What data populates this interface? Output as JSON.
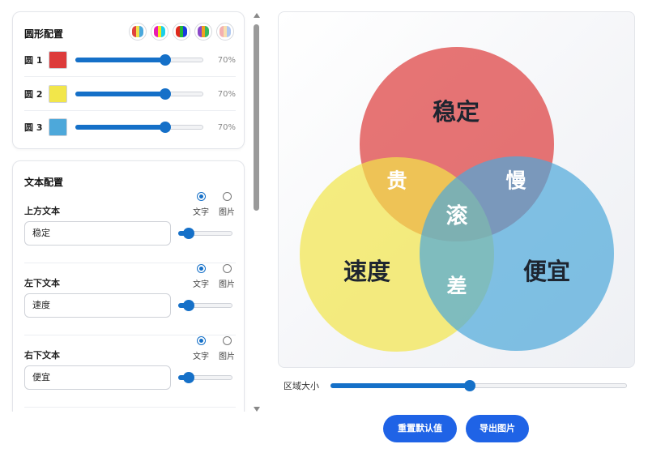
{
  "shape_panel": {
    "title": "圆形配置",
    "presets": [
      {
        "name": "palette-1",
        "colors": [
          "#e0443c",
          "#f0e04a",
          "#4aa8dc"
        ]
      },
      {
        "name": "palette-2",
        "colors": [
          "#e81cb0",
          "#f5e81a",
          "#1ad0e8"
        ]
      },
      {
        "name": "palette-3",
        "colors": [
          "#e0281c",
          "#22b83a",
          "#1a3ae0"
        ]
      },
      {
        "name": "palette-4",
        "colors": [
          "#8a48c8",
          "#f0a020",
          "#38b860"
        ]
      },
      {
        "name": "palette-5",
        "colors": [
          "#f4b0b0",
          "#f8e0b0",
          "#b0c8f0"
        ]
      }
    ],
    "circles": [
      {
        "label": "圆 1",
        "color": "#dd3b3b",
        "opacity_text": "70%",
        "opacity": 0.7
      },
      {
        "label": "圆 2",
        "color": "#f2e64a",
        "opacity_text": "70%",
        "opacity": 0.7
      },
      {
        "label": "圆 3",
        "color": "#4da8da",
        "opacity_text": "70%",
        "opacity": 0.7
      }
    ]
  },
  "text_panel": {
    "title": "文本配置",
    "option_text": "文字",
    "option_image": "图片",
    "blocks": [
      {
        "label": "上方文本",
        "value": "稳定",
        "size": 0.2
      },
      {
        "label": "左下文本",
        "value": "速度",
        "size": 0.2
      },
      {
        "label": "右下文本",
        "value": "便宜",
        "size": 0.2
      }
    ]
  },
  "venn": {
    "top": "稳定",
    "left": "速度",
    "right": "便宜",
    "top_left": "贵",
    "top_right": "慢",
    "center": "滚",
    "bottom": "差",
    "colors": {
      "top": "#dd3b3b",
      "left": "#f2e64a",
      "right": "#4da8da"
    }
  },
  "area_control": {
    "label": "区域大小",
    "value": 0.47
  },
  "buttons": {
    "reset": "重置默认值",
    "export": "导出图片"
  }
}
